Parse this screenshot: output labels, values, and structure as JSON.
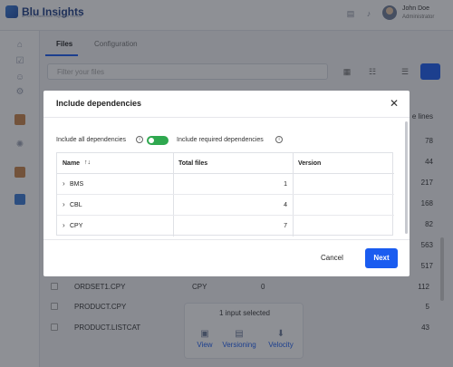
{
  "app": {
    "logo_title": "Blu Insights",
    "logo_subtitle": "an AWS Mainframe Migration Service"
  },
  "user": {
    "name": "John Doe",
    "role": "Administrator"
  },
  "tabs": [
    "Files",
    "Configuration"
  ],
  "filter": {
    "placeholder": "Filter your files"
  },
  "background_column_header": "e lines",
  "background_right_values": [
    "78",
    "44",
    "217",
    "168",
    "82",
    "563",
    "517"
  ],
  "background_rows": [
    {
      "name": "ORDSET1.CPY",
      "type": "CPY",
      "extra": "0",
      "lines": "112"
    },
    {
      "name": "PRODUCT.CPY",
      "type": "",
      "extra": "",
      "lines": "5"
    },
    {
      "name": "PRODUCT.LISTCAT",
      "type": "",
      "extra": "",
      "lines": "43"
    }
  ],
  "selection_popup": {
    "title": "1 input selected",
    "actions": [
      {
        "label": "View",
        "icon": "view-icon"
      },
      {
        "label": "Versioning",
        "icon": "versioning-icon"
      },
      {
        "label": "Velocity",
        "icon": "velocity-icon"
      }
    ]
  },
  "modal": {
    "title": "Include dependencies",
    "include_all_label": "Include all dependencies",
    "include_all_enabled": true,
    "include_required_label": "Include required dependencies",
    "table": {
      "headers": [
        "Name",
        "Total files",
        "Version"
      ],
      "rows": [
        {
          "name": "BMS",
          "total_files": "1",
          "version": ""
        },
        {
          "name": "CBL",
          "total_files": "4",
          "version": ""
        },
        {
          "name": "CPY",
          "total_files": "7",
          "version": ""
        }
      ]
    },
    "cancel_label": "Cancel",
    "next_label": "Next"
  },
  "colors": {
    "primary": "#1a5cf0",
    "toggle_on": "#2fa84f"
  }
}
